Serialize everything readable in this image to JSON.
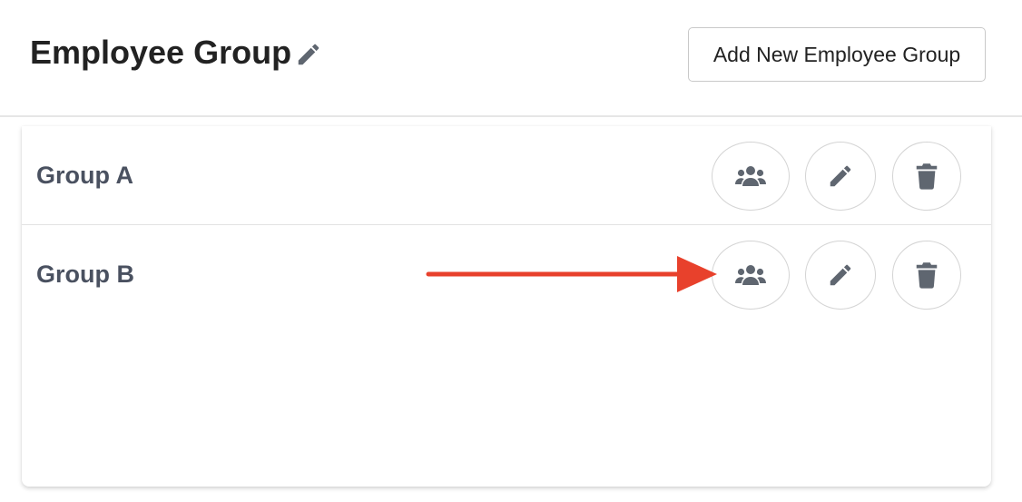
{
  "header": {
    "title": "Employee Group",
    "title_edit_icon": "pencil-icon",
    "add_button_label": "Add New Employee Group"
  },
  "groups": [
    {
      "label": "Group A",
      "actions": [
        "users-icon",
        "pencil-icon",
        "trash-icon"
      ]
    },
    {
      "label": "Group B",
      "actions": [
        "users-icon",
        "pencil-icon",
        "trash-icon"
      ]
    }
  ],
  "annotation": {
    "type": "arrow",
    "color": "#e8412c",
    "points_to": "Group B members button"
  },
  "colors": {
    "icon": "#5f6670",
    "label": "#4a5160",
    "border": "#d4d4d4"
  }
}
